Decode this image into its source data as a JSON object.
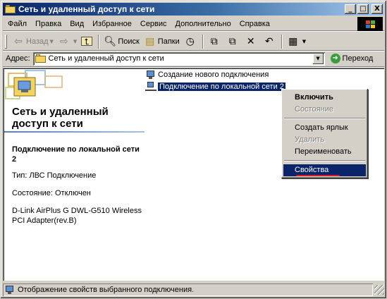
{
  "window": {
    "title": "Сеть и удаленный доступ к сети",
    "minimize": "_",
    "maximize": "□",
    "close": "X"
  },
  "menubar": {
    "items": [
      "Файл",
      "Правка",
      "Вид",
      "Избранное",
      "Сервис",
      "Дополнительно",
      "Справка"
    ]
  },
  "toolbar": {
    "back_label": "Назад",
    "search_label": "Поиск",
    "folders_label": "Папки"
  },
  "address": {
    "label": "Адрес:",
    "value": "Сеть и удаленный доступ к сети",
    "go_label": "Переход"
  },
  "panel": {
    "title": "Сеть и удаленный доступ к сети",
    "subtitle": "Подключение по локальной сети 2",
    "type_line": "Тип: ЛВС Подключение",
    "status_line": "Состояние: Отключен",
    "device_line": "D-Link AirPlus G DWL-G510 Wireless PCI Adapter(rev.B)"
  },
  "connections": [
    {
      "label": "Создание нового подключения",
      "selected": false
    },
    {
      "label": "Подключение по локальной сети 2",
      "selected": true
    }
  ],
  "context_menu": {
    "items": [
      {
        "label": "Включить",
        "bold": true,
        "disabled": false
      },
      {
        "label": "Состояние",
        "bold": false,
        "disabled": true
      },
      {
        "label": "Создать ярлык",
        "bold": false,
        "disabled": false
      },
      {
        "label": "Удалить",
        "bold": false,
        "disabled": true
      },
      {
        "label": "Переименовать",
        "bold": false,
        "disabled": false
      },
      {
        "label": "Свойства",
        "bold": false,
        "disabled": false,
        "highlighted": true
      }
    ]
  },
  "statusbar": {
    "text": "Отображение свойств выбранного подключения."
  },
  "colors": {
    "titlebar_start": "#0a246a",
    "selection": "#0a246a",
    "face": "#d4d0c8",
    "annotation_underline": "#d02020"
  }
}
